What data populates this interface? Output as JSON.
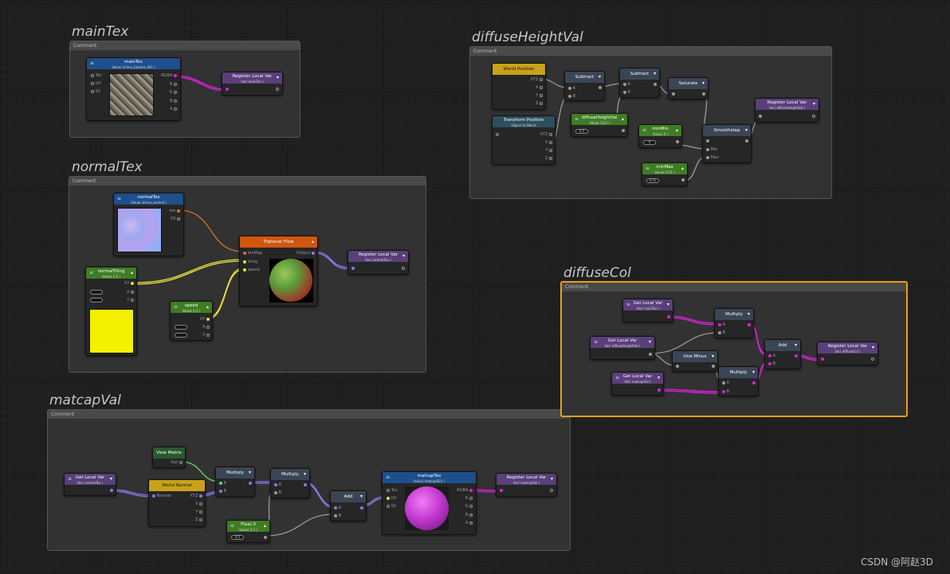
{
  "groups": {
    "mainTex": {
      "title": "mainTex",
      "comment": "Comment"
    },
    "normalTex": {
      "title": "normalTex",
      "comment": "Comment"
    },
    "matcapVal": {
      "title": "matcapVal",
      "comment": "Comment"
    },
    "diffuseHeightVal": {
      "title": "diffuseHeightVal",
      "comment": "Comment"
    },
    "diffuseCol": {
      "title": "diffuseCol",
      "comment": "Comment"
    }
  },
  "nodes": {
    "mainTex": {
      "title": "mainTex",
      "sub": "Value( shimo_tabolet_4K1 )",
      "in": [
        "Tex",
        "UV",
        "SS"
      ],
      "out": [
        "RGBA",
        "R",
        "G",
        "B",
        "A"
      ]
    },
    "regMainTex": {
      "title": "Register Local Var",
      "sub": "Var( mainTex )"
    },
    "normalTex": {
      "title": "normalTex",
      "sub": "Value( shimo_normal )",
      "out": [
        "tex",
        "SS"
      ]
    },
    "normalTiling": {
      "title": "normalTiling",
      "sub": "Value( 2,2 )",
      "out": [
        "XY",
        "X",
        "Y"
      ]
    },
    "speed": {
      "title": "speed",
      "sub": "Value( 0,1 )",
      "out": [
        "XY",
        "X",
        "Y"
      ]
    },
    "triplanar": {
      "title": "Triplanar Flow",
      "in": [
        "texMap",
        "tiling",
        "speed"
      ],
      "out": [
        "Output"
      ]
    },
    "regNormalTex": {
      "title": "Register Local Var",
      "sub": "Var( normalTex )"
    },
    "getNormalTex": {
      "title": "Get Local Var",
      "sub": "Var( normalTex )"
    },
    "viewMatrix": {
      "title": "View Matrix",
      "out": [
        "Out"
      ]
    },
    "worldNormal": {
      "title": "World Normal",
      "in": [
        "Normal"
      ],
      "out": [
        "XYZ",
        "X",
        "Y",
        "Z"
      ]
    },
    "mult1": {
      "title": "Multiply",
      "in": [
        "A",
        "B"
      ]
    },
    "mult2": {
      "title": "Multiply",
      "in": [
        "A",
        "B"
      ]
    },
    "float0": {
      "title": "Float 0",
      "sub": "Value( 0,5 )",
      "value": "0,5"
    },
    "addMat": {
      "title": "Add",
      "in": [
        "A",
        "B"
      ]
    },
    "matcapTex": {
      "title": "matcapTex",
      "sub": "Value( matcap021 )",
      "in": [
        "Tex",
        "UV",
        "SS"
      ],
      "out": [
        "RGBA",
        "R",
        "G",
        "B",
        "A"
      ]
    },
    "regMatcap": {
      "title": "Register Local Var",
      "sub": "Var( matcapVal )"
    },
    "worldPosition": {
      "title": "World Position",
      "out": [
        "XYZ",
        "X",
        "Y",
        "Z"
      ]
    },
    "transformPosition": {
      "title": "Transform Position",
      "sub": "Object to World",
      "out": [
        "XYZ",
        "X",
        "Y",
        "Z"
      ]
    },
    "sub1": {
      "title": "Subtract",
      "in": [
        "A",
        "B"
      ]
    },
    "sub2": {
      "title": "Subtract",
      "in": [
        "A",
        "B"
      ]
    },
    "diffuseHeightValNode": {
      "title": "diffuseHeightVal",
      "sub": "Value( 10,0 )",
      "value": "0,5"
    },
    "saturate": {
      "title": "Saturate"
    },
    "minNode": {
      "title": "minMin",
      "sub": "Value( 0 )",
      "value": "0"
    },
    "maxNode": {
      "title": "minMax",
      "sub": "Value( 0,51 )",
      "value": "0,51"
    },
    "smoothstep": {
      "title": "Smoothstep",
      "in": [
        "",
        "Min",
        "Max"
      ]
    },
    "regDiffuseHeight": {
      "title": "Register Local Var",
      "sub": "Var( diffuseHeightVal )"
    },
    "getMainTex": {
      "title": "Get Local Var",
      "sub": "Var( mainTex )"
    },
    "getDiffuseHeight": {
      "title": "Get Local Var",
      "sub": "Var( diffuseHeightVal )"
    },
    "getMatcap": {
      "title": "Get Local Var",
      "sub": "Var( matcapVal )"
    },
    "multC1": {
      "title": "Multiply",
      "in": [
        "A",
        "B"
      ]
    },
    "oneMinus": {
      "title": "One Minus"
    },
    "multC2": {
      "title": "Multiply",
      "in": [
        "A",
        "B"
      ]
    },
    "addC": {
      "title": "Add",
      "in": [
        "A",
        "B"
      ]
    },
    "regDiffuseCol": {
      "title": "Register Local Var",
      "sub": "Var( diffuseCol )"
    }
  },
  "colors": {
    "pink": "#e020e0",
    "purple": "#8a7ae8",
    "yellow": "#e8e040",
    "orange": "#e07020",
    "gray": "#9a9a9a",
    "green": "#60e060",
    "selected": "#e8a015"
  },
  "watermark": "CSDN @阿赵3D"
}
